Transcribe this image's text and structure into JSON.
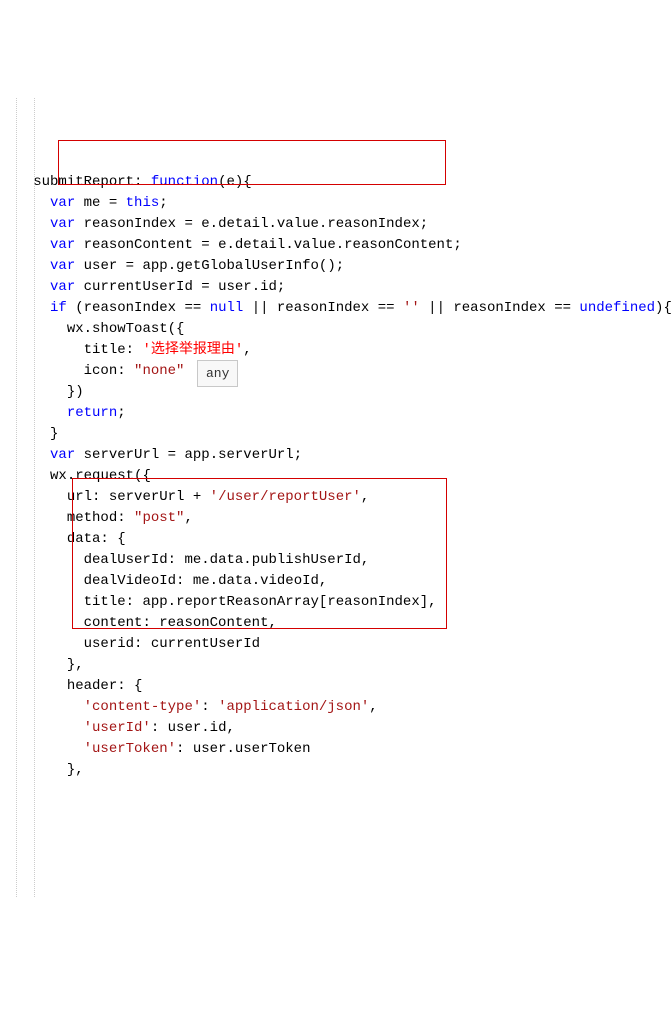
{
  "tooltip": "any",
  "lines": [
    {
      "indent": "   ",
      "tokens": [
        [
          "ident",
          "submitReport"
        ],
        [
          "punct",
          ": "
        ],
        [
          "kw",
          "function"
        ],
        [
          "punct",
          "("
        ],
        [
          "ident",
          "e"
        ],
        [
          "punct",
          "){"
        ]
      ]
    },
    {
      "indent": "     ",
      "tokens": [
        [
          "kw",
          "var"
        ],
        [
          "ident",
          " me "
        ],
        [
          "punct",
          "= "
        ],
        [
          "kw",
          "this"
        ],
        [
          "punct",
          ";"
        ]
      ]
    },
    {
      "indent": "     ",
      "tokens": [
        [
          "kw",
          "var"
        ],
        [
          "ident",
          " reasonIndex "
        ],
        [
          "punct",
          "= "
        ],
        [
          "ident",
          "e"
        ],
        [
          "punct",
          "."
        ],
        [
          "ident",
          "detail"
        ],
        [
          "punct",
          "."
        ],
        [
          "ident",
          "value"
        ],
        [
          "punct",
          "."
        ],
        [
          "ident",
          "reasonIndex"
        ],
        [
          "punct",
          ";"
        ]
      ]
    },
    {
      "indent": "     ",
      "tokens": [
        [
          "kw",
          "var"
        ],
        [
          "ident",
          " reasonContent "
        ],
        [
          "punct",
          "= "
        ],
        [
          "ident",
          "e"
        ],
        [
          "punct",
          "."
        ],
        [
          "ident",
          "detail"
        ],
        [
          "punct",
          "."
        ],
        [
          "ident",
          "value"
        ],
        [
          "punct",
          "."
        ],
        [
          "ident",
          "reasonContent"
        ],
        [
          "punct",
          ";"
        ]
      ]
    },
    {
      "indent": "     ",
      "tokens": [
        [
          "kw",
          "var"
        ],
        [
          "ident",
          " user "
        ],
        [
          "punct",
          "= "
        ],
        [
          "ident",
          "app"
        ],
        [
          "punct",
          "."
        ],
        [
          "ident",
          "getGlobalUserInfo"
        ],
        [
          "punct",
          "();"
        ]
      ]
    },
    {
      "indent": "     ",
      "tokens": [
        [
          "kw",
          "var"
        ],
        [
          "ident",
          " currentUserId "
        ],
        [
          "punct",
          "= "
        ],
        [
          "ident",
          "user"
        ],
        [
          "punct",
          "."
        ],
        [
          "ident",
          "id"
        ],
        [
          "punct",
          ";"
        ]
      ]
    },
    {
      "indent": "     ",
      "tokens": [
        [
          "kw",
          "if"
        ],
        [
          "punct",
          " ("
        ],
        [
          "ident",
          "reasonIndex "
        ],
        [
          "punct",
          "== "
        ],
        [
          "kw",
          "null"
        ],
        [
          "punct",
          " || "
        ],
        [
          "ident",
          "reasonIndex "
        ],
        [
          "punct",
          "== "
        ],
        [
          "str",
          "''"
        ],
        [
          "punct",
          " || "
        ],
        [
          "ident",
          "reasonIndex "
        ],
        [
          "punct",
          "== "
        ],
        [
          "kw",
          "undefined"
        ],
        [
          "punct",
          "){"
        ]
      ]
    },
    {
      "indent": "       ",
      "tokens": [
        [
          "ident",
          "wx"
        ],
        [
          "punct",
          "."
        ],
        [
          "ident",
          "showToast"
        ],
        [
          "punct",
          "({"
        ]
      ]
    },
    {
      "indent": "         ",
      "tokens": [
        [
          "ident",
          "title"
        ],
        [
          "punct",
          ": "
        ],
        [
          "str-zh",
          "'选择举报理由'"
        ],
        [
          "punct",
          ","
        ]
      ]
    },
    {
      "indent": "         ",
      "tokens": [
        [
          "ident",
          "icon"
        ],
        [
          "punct",
          ": "
        ],
        [
          "str",
          "\"none\""
        ]
      ]
    },
    {
      "indent": "       ",
      "tokens": [
        [
          "punct",
          "})"
        ]
      ]
    },
    {
      "indent": "       ",
      "tokens": [
        [
          "kw",
          "return"
        ],
        [
          "punct",
          ";"
        ]
      ]
    },
    {
      "indent": "     ",
      "tokens": [
        [
          "punct",
          "}"
        ]
      ]
    },
    {
      "indent": "     ",
      "tokens": [
        [
          "kw",
          "var"
        ],
        [
          "ident",
          " serverUrl "
        ],
        [
          "punct",
          "= "
        ],
        [
          "ident",
          "app"
        ],
        [
          "punct",
          "."
        ],
        [
          "ident",
          "serverUrl"
        ],
        [
          "punct",
          ";"
        ]
      ]
    },
    {
      "indent": "     ",
      "tokens": [
        [
          "ident",
          "wx"
        ],
        [
          "punct",
          "."
        ],
        [
          "ident",
          "request"
        ],
        [
          "punct",
          "({"
        ]
      ]
    },
    {
      "indent": "       ",
      "tokens": [
        [
          "ident",
          "url"
        ],
        [
          "punct",
          ": "
        ],
        [
          "ident",
          "serverUrl "
        ],
        [
          "punct",
          "+ "
        ],
        [
          "str",
          "'/user/reportUser'"
        ],
        [
          "punct",
          ","
        ]
      ]
    },
    {
      "indent": "       ",
      "tokens": [
        [
          "ident",
          "method"
        ],
        [
          "punct",
          ": "
        ],
        [
          "str",
          "\"post\""
        ],
        [
          "punct",
          ","
        ]
      ]
    },
    {
      "indent": "       ",
      "tokens": [
        [
          "ident",
          "data"
        ],
        [
          "punct",
          ": {"
        ]
      ]
    },
    {
      "indent": "         ",
      "tokens": [
        [
          "ident",
          "dealUserId"
        ],
        [
          "punct",
          ": "
        ],
        [
          "ident",
          "me"
        ],
        [
          "punct",
          "."
        ],
        [
          "ident",
          "data"
        ],
        [
          "punct",
          "."
        ],
        [
          "ident",
          "publishUserId"
        ],
        [
          "punct",
          ","
        ]
      ]
    },
    {
      "indent": "         ",
      "tokens": [
        [
          "ident",
          "dealVideoId"
        ],
        [
          "punct",
          ": "
        ],
        [
          "ident",
          "me"
        ],
        [
          "punct",
          "."
        ],
        [
          "ident",
          "data"
        ],
        [
          "punct",
          "."
        ],
        [
          "ident",
          "videoId"
        ],
        [
          "punct",
          ","
        ]
      ]
    },
    {
      "indent": "         ",
      "tokens": [
        [
          "ident",
          "title"
        ],
        [
          "punct",
          ": "
        ],
        [
          "ident",
          "app"
        ],
        [
          "punct",
          "."
        ],
        [
          "ident",
          "reportReasonArray"
        ],
        [
          "punct",
          "["
        ],
        [
          "ident",
          "reasonIndex"
        ],
        [
          "punct",
          "],"
        ]
      ]
    },
    {
      "indent": "         ",
      "tokens": [
        [
          "ident",
          "content"
        ],
        [
          "punct",
          ": "
        ],
        [
          "ident",
          "reasonContent"
        ],
        [
          "punct",
          ","
        ]
      ]
    },
    {
      "indent": "         ",
      "tokens": [
        [
          "ident",
          "userid"
        ],
        [
          "punct",
          ": "
        ],
        [
          "ident",
          "currentUserId"
        ]
      ]
    },
    {
      "indent": "       ",
      "tokens": [
        [
          "punct",
          "},"
        ]
      ]
    },
    {
      "indent": "       ",
      "tokens": [
        [
          "ident",
          "header"
        ],
        [
          "punct",
          ": {"
        ]
      ]
    },
    {
      "indent": "         ",
      "tokens": [
        [
          "str",
          "'content-type'"
        ],
        [
          "punct",
          ": "
        ],
        [
          "str",
          "'application/json'"
        ],
        [
          "punct",
          ","
        ]
      ]
    },
    {
      "indent": "         ",
      "tokens": [
        [
          "str",
          "'userId'"
        ],
        [
          "punct",
          ": "
        ],
        [
          "ident",
          "user"
        ],
        [
          "punct",
          "."
        ],
        [
          "ident",
          "id"
        ],
        [
          "punct",
          ","
        ]
      ]
    },
    {
      "indent": "         ",
      "tokens": [
        [
          "str",
          "'userToken'"
        ],
        [
          "punct",
          ": "
        ],
        [
          "ident",
          "user"
        ],
        [
          "punct",
          "."
        ],
        [
          "ident",
          "userToken"
        ]
      ]
    },
    {
      "indent": "       ",
      "tokens": [
        [
          "punct",
          "},"
        ]
      ]
    }
  ]
}
